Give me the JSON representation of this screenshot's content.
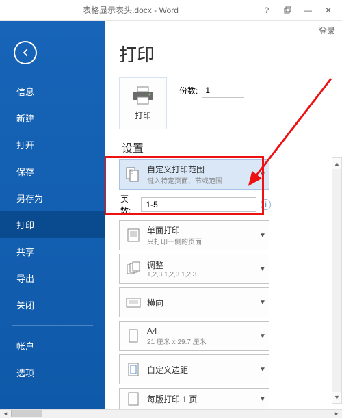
{
  "window": {
    "title": "表格显示表头.docx - Word",
    "login": "登录"
  },
  "sidebar": {
    "items": [
      {
        "label": "信息"
      },
      {
        "label": "新建"
      },
      {
        "label": "打开"
      },
      {
        "label": "保存"
      },
      {
        "label": "另存为"
      },
      {
        "label": "打印"
      },
      {
        "label": "共享"
      },
      {
        "label": "导出"
      },
      {
        "label": "关闭"
      },
      {
        "label": "帐户"
      },
      {
        "label": "选项"
      }
    ],
    "active_index": 5
  },
  "page": {
    "heading": "打印",
    "print_button": "打印",
    "copies_label": "份数:",
    "copies_value": "1",
    "settings_heading": "设置",
    "pages_label": "页数:",
    "pages_value": "1-5",
    "options": [
      {
        "title": "自定义打印范围",
        "sub": "键入特定页面、节或范围"
      },
      {
        "title": "单面打印",
        "sub": "只打印一侧的页面"
      },
      {
        "title": "调整",
        "sub": "1,2,3   1,2,3   1,2,3"
      },
      {
        "title": "横向",
        "sub": ""
      },
      {
        "title": "A4",
        "sub": "21 厘米 x 29.7 厘米"
      },
      {
        "title": "自定义边距",
        "sub": ""
      },
      {
        "title": "每版打印 1 页",
        "sub": ""
      }
    ]
  }
}
